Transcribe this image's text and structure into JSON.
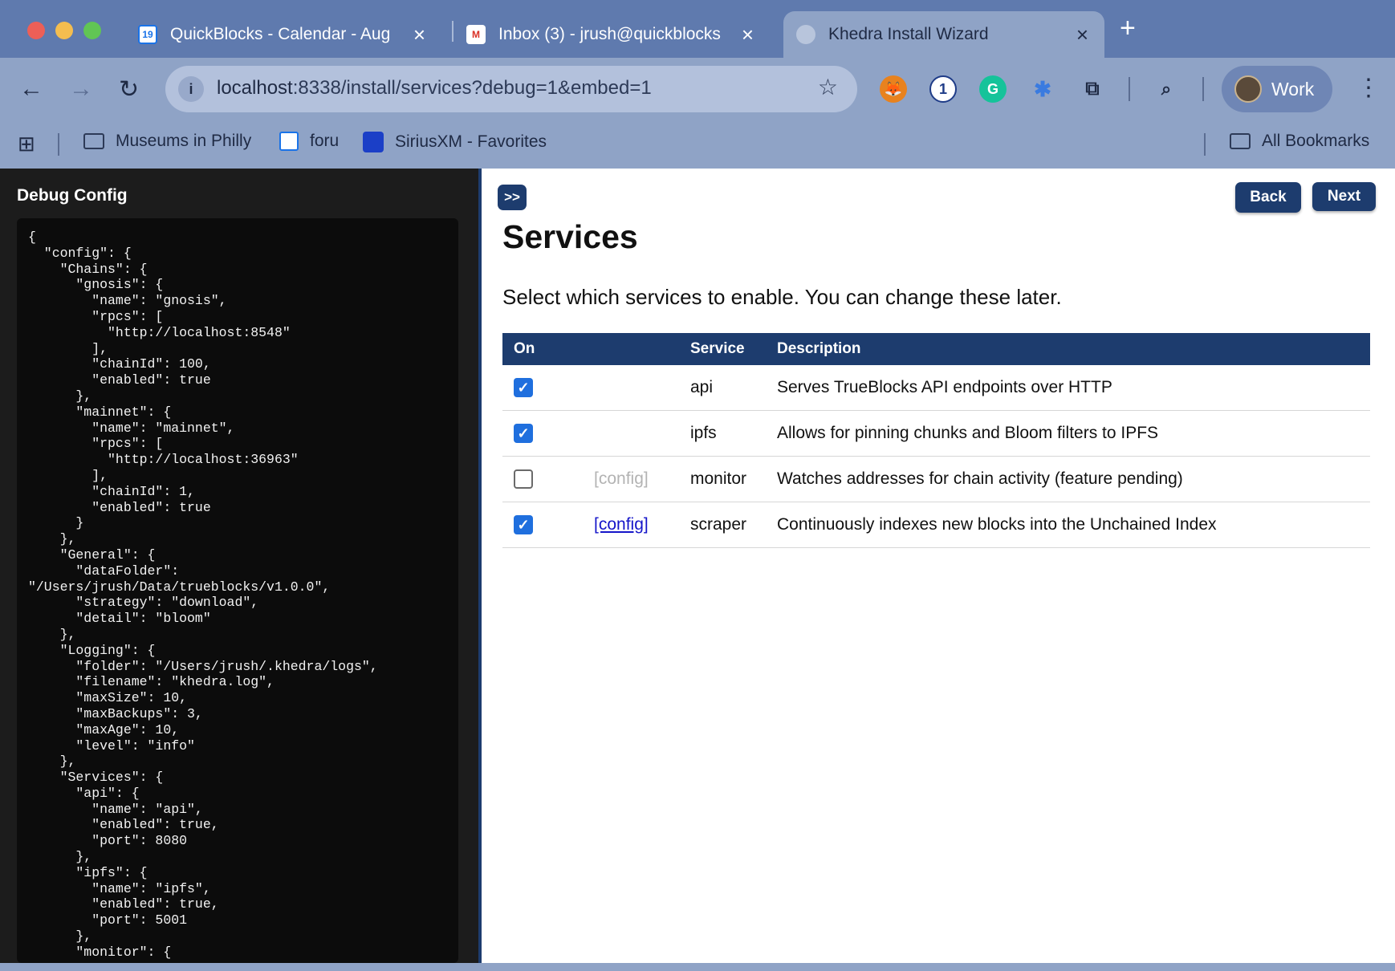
{
  "browser": {
    "tabs": [
      {
        "favicon": "calendar-icon",
        "title": "QuickBlocks - Calendar - Aug"
      },
      {
        "favicon": "gmail-icon",
        "title": "Inbox (3) - jrush@quickblocks"
      },
      {
        "favicon": "globe-icon",
        "title": "Khedra Install Wizard"
      }
    ],
    "url_host": "localhost",
    "url_path": ":8338/install/services?debug=1&embed=1",
    "profile_label": "Work",
    "bookmarks": [
      {
        "icon": "folder-icon",
        "label": "Museums in Philly"
      },
      {
        "icon": "calendar-icon",
        "label": "foru"
      },
      {
        "icon": "siriusxm-icon",
        "label": "SiriusXM - Favorites"
      }
    ],
    "all_bookmarks": "All Bookmarks"
  },
  "debug": {
    "title": "Debug Config",
    "code": "{\n  \"config\": {\n    \"Chains\": {\n      \"gnosis\": {\n        \"name\": \"gnosis\",\n        \"rpcs\": [\n          \"http://localhost:8548\"\n        ],\n        \"chainId\": 100,\n        \"enabled\": true\n      },\n      \"mainnet\": {\n        \"name\": \"mainnet\",\n        \"rpcs\": [\n          \"http://localhost:36963\"\n        ],\n        \"chainId\": 1,\n        \"enabled\": true\n      }\n    },\n    \"General\": {\n      \"dataFolder\":\n\"/Users/jrush/Data/trueblocks/v1.0.0\",\n      \"strategy\": \"download\",\n      \"detail\": \"bloom\"\n    },\n    \"Logging\": {\n      \"folder\": \"/Users/jrush/.khedra/logs\",\n      \"filename\": \"khedra.log\",\n      \"maxSize\": 10,\n      \"maxBackups\": 3,\n      \"maxAge\": 10,\n      \"level\": \"info\"\n    },\n    \"Services\": {\n      \"api\": {\n        \"name\": \"api\",\n        \"enabled\": true,\n        \"port\": 8080\n      },\n      \"ipfs\": {\n        \"name\": \"ipfs\",\n        \"enabled\": true,\n        \"port\": 5001\n      },\n      \"monitor\": {"
  },
  "wizard": {
    "toggle_label": ">>",
    "back_label": "Back",
    "next_label": "Next",
    "title": "Services",
    "subtitle": "Select which services to enable. You can change these later.",
    "headers": {
      "on": "On",
      "config": "",
      "service": "Service",
      "description": "Description"
    },
    "rows": [
      {
        "enabled": true,
        "config": "",
        "config_active": false,
        "service": "api",
        "description": "Serves TrueBlocks API endpoints over HTTP"
      },
      {
        "enabled": true,
        "config": "",
        "config_active": false,
        "service": "ipfs",
        "description": "Allows for pinning chunks and Bloom filters to IPFS"
      },
      {
        "enabled": false,
        "config": "[config]",
        "config_active": false,
        "service": "monitor",
        "description": "Watches addresses for chain activity (feature pending)"
      },
      {
        "enabled": true,
        "config": "[config]",
        "config_active": true,
        "service": "scraper",
        "description": "Continuously indexes new blocks into the Unchained Index"
      }
    ]
  }
}
